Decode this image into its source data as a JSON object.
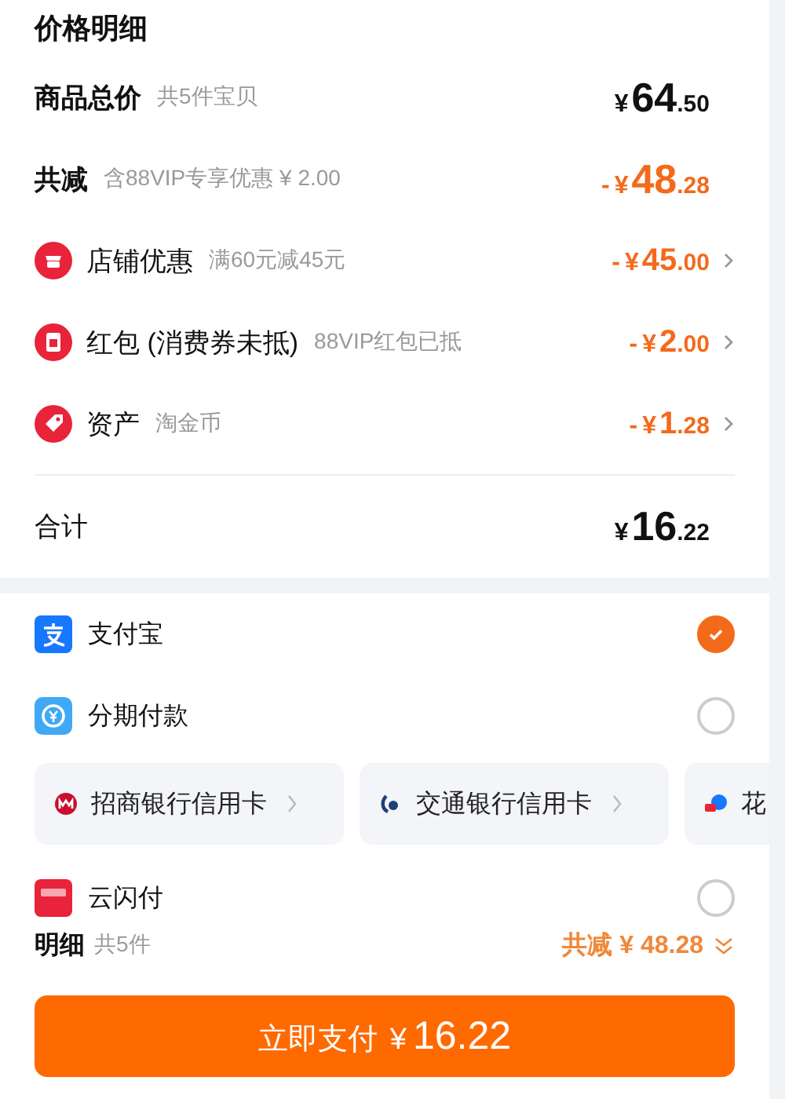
{
  "title": "价格明细",
  "rows": [
    {
      "kind": "subtotal",
      "label": "商品总价",
      "note": "共5件宝贝",
      "price": {
        "currency": "¥",
        "integer": "64",
        "fraction": ".50"
      },
      "expandable": false
    },
    {
      "kind": "discount",
      "label": "共减",
      "note": "含88VIP专享优惠 ¥ 2.00",
      "price": {
        "sign": "-",
        "currency": "¥",
        "integer": "48",
        "fraction": ".28"
      },
      "expandable": false
    },
    {
      "kind": "coupon",
      "label": "店铺优惠",
      "note": "满60元减45元",
      "price": {
        "sign": "-",
        "currency": "¥",
        "integer": "45",
        "fraction": ".00"
      },
      "expandable": true
    },
    {
      "kind": "coupon",
      "label": "红包 (消费券未抵)",
      "note": "88VIP红包已抵",
      "price": {
        "sign": "-",
        "currency": "¥",
        "integer": "2",
        "fraction": ".00"
      },
      "expandable": true
    },
    {
      "kind": "coupon",
      "label": "资产",
      "note": "淘金币",
      "price": {
        "sign": "-",
        "currency": "¥",
        "integer": "1",
        "fraction": ".28"
      },
      "expandable": true
    }
  ],
  "total": {
    "label": "合计",
    "price": {
      "currency": "¥",
      "integer": "16",
      "fraction": ".22"
    }
  },
  "payment_methods": [
    {
      "label": "支付宝",
      "selected": true
    },
    {
      "label": "分期付款",
      "selected": false,
      "kind": "installment"
    },
    {
      "label": "云闪付",
      "selected": false
    }
  ],
  "installment_cards": [
    {
      "label": "招商银行信用卡"
    },
    {
      "label": "交通银行信用卡"
    },
    {
      "label": "花"
    }
  ],
  "footer": {
    "label": "明细",
    "count": "共5件",
    "discount": "共减 ¥ 48.28",
    "button": {
      "label": "立即支付",
      "currency": "¥",
      "amount": "16.22"
    }
  }
}
